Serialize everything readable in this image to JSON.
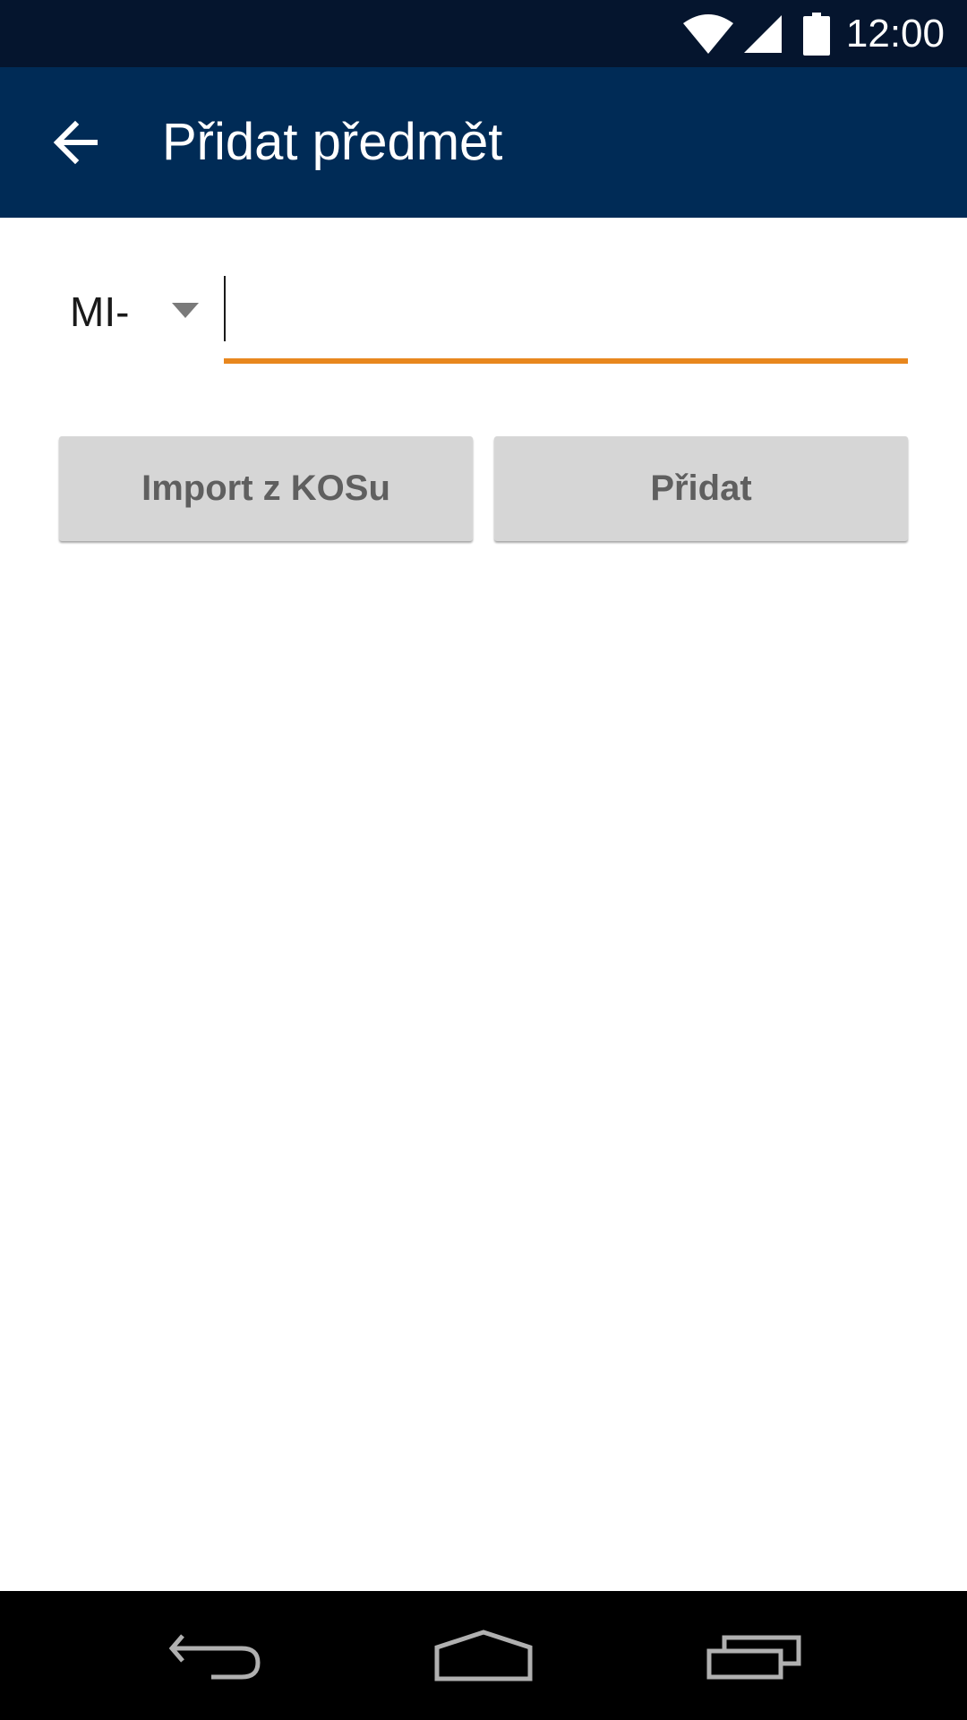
{
  "status_bar": {
    "time": "12:00",
    "icons": [
      "wifi-icon",
      "cellular-signal-icon",
      "battery-icon"
    ],
    "background": "#05152e"
  },
  "toolbar": {
    "title": "Přidat předmět",
    "back_icon": "arrow-back-icon",
    "background": "#002b56"
  },
  "form": {
    "prefix_selected": "MI-",
    "code_value": "",
    "accent_color": "#e8871e"
  },
  "buttons": {
    "import_label": "Import z KOSu",
    "add_label": "Přidat"
  },
  "nav_bar": {
    "icons": [
      "nav-back-icon",
      "nav-home-icon",
      "nav-recents-icon"
    ]
  }
}
